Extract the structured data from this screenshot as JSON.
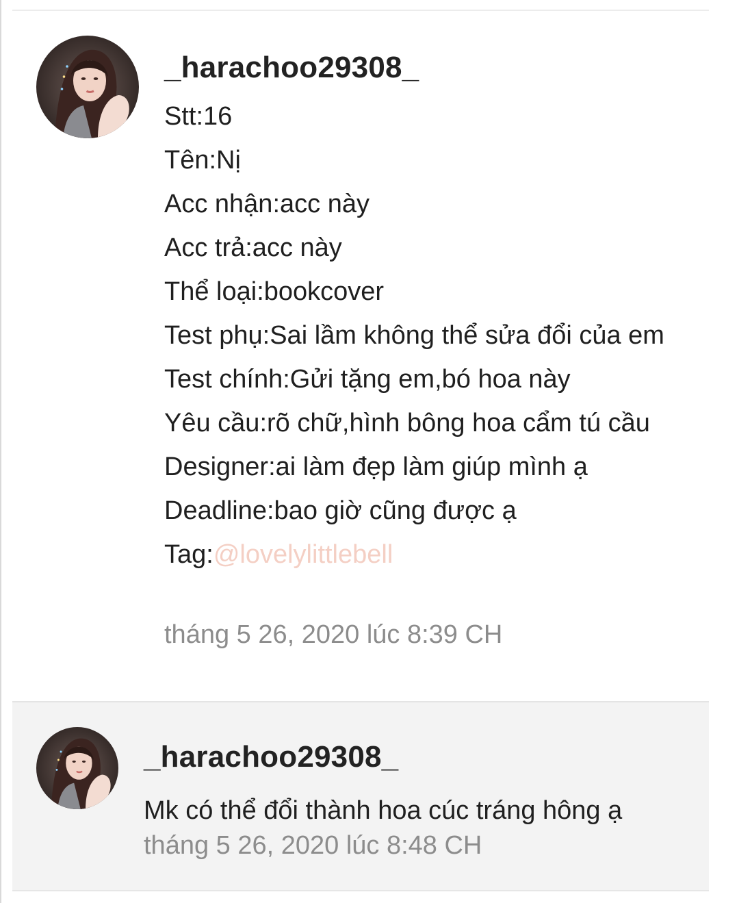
{
  "comments": [
    {
      "username": "_harachoo29308_",
      "avatar_icon": "profile-photo",
      "lines": [
        "Stt:16",
        "Tên:Nị",
        "Acc nhận:acc này",
        "Acc trả:acc này",
        "Thể loại:bookcover",
        "Test phụ:Sai lầm không thể sửa đổi của em",
        "Test chính:Gửi tặng em,bó hoa này",
        "Yêu cầu:rõ chữ,hình bông hoa cẩm tú cầu",
        "Designer:ai làm đẹp làm giúp mình ạ",
        "Deadline:bao giờ cũng được ạ"
      ],
      "tag_label": "Tag:",
      "tag_mention": "@lovelylittlebell",
      "timestamp": "tháng 5 26, 2020 lúc 8:39 CH"
    },
    {
      "username": "_harachoo29308_",
      "avatar_icon": "profile-photo",
      "text": "Mk có thể đổi thành hoa cúc tráng hông ạ",
      "timestamp": "tháng 5 26, 2020 lúc 8:48 CH"
    }
  ],
  "colors": {
    "username": "#222222",
    "text": "#1f1f1f",
    "timestamp": "#8c8c8c",
    "mention": "#f4cfc4",
    "reply_background": "#f3f3f3"
  }
}
